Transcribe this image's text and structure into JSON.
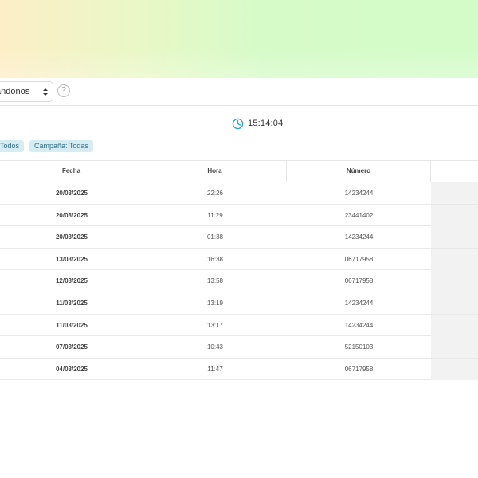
{
  "toolbar": {
    "select_value": "andonos",
    "help_label": "?"
  },
  "clock": {
    "time": "15:14:04",
    "icon": "clock-icon"
  },
  "filters": [
    {
      "label": "Todos"
    },
    {
      "label": "Campaña: Todas"
    }
  ],
  "table": {
    "columns": [
      "Fecha",
      "Hora",
      "Número",
      ""
    ],
    "rows": [
      {
        "fecha": "20/03/2025",
        "hora": "22:26",
        "numero": "14234244"
      },
      {
        "fecha": "20/03/2025",
        "hora": "11:29",
        "numero": "23441402"
      },
      {
        "fecha": "20/03/2025",
        "hora": "01:38",
        "numero": "14234244"
      },
      {
        "fecha": "13/03/2025",
        "hora": "16:38",
        "numero": "06717958"
      },
      {
        "fecha": "12/03/2025",
        "hora": "13:58",
        "numero": "06717958"
      },
      {
        "fecha": "11/03/2025",
        "hora": "13:19",
        "numero": "14234244"
      },
      {
        "fecha": "11/03/2025",
        "hora": "13:17",
        "numero": "14234244"
      },
      {
        "fecha": "07/03/2025",
        "hora": "10:43",
        "numero": "52150103"
      },
      {
        "fecha": "04/03/2025",
        "hora": "11:47",
        "numero": "06717958"
      }
    ]
  },
  "colors": {
    "accent": "#2aa7d6",
    "chip_bg": "#d6ecf3",
    "chip_text": "#2f6f85"
  }
}
